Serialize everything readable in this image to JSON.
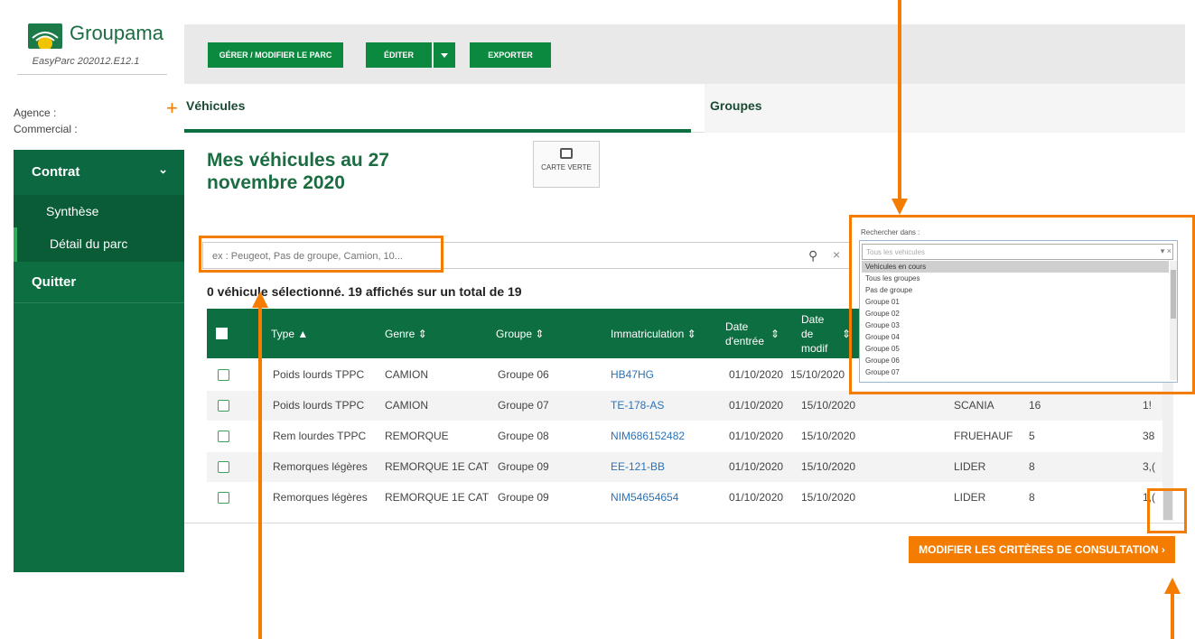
{
  "brand": {
    "name": "Groupama",
    "version": "EasyParc 202012.E12.1"
  },
  "sidebar": {
    "agence_label": "Agence :",
    "commercial_label": "Commercial :",
    "add_icon": "plus-icon",
    "menu": {
      "contrat": "Contrat",
      "synthese": "Synthèse",
      "detail": "Détail du parc",
      "quitter": "Quitter"
    }
  },
  "toolbar": {
    "gerer": "GÉRER / MODIFIER LE PARC",
    "editer": "ÉDITER",
    "exporter": "EXPORTER"
  },
  "tabs": {
    "vehicules": "Véhicules",
    "groupes": "Groupes"
  },
  "main": {
    "title": "Mes véhicules au 27 novembre 2020",
    "carte_verte": "CARTE VERTE",
    "search_placeholder": "ex : Peugeot, Pas de groupe, Camion, 10...",
    "selection_info": "0 véhicule sélectionné. 19 affichés sur un total de 19",
    "modify_button": "MODIFIER LES CRITÈRES DE CONSULTATION"
  },
  "filter": {
    "label": "Rechercher dans :",
    "placeholder": "Tous les vehicules",
    "options": [
      "Vehicules en cours",
      "Tous les groupes",
      "Pas de groupe",
      "Groupe 01",
      "Groupe 02",
      "Groupe 03",
      "Groupe 04",
      "Groupe 05",
      "Groupe 06",
      "Groupe 07"
    ],
    "highlighted_index": 0
  },
  "table": {
    "headers": {
      "type": "Type",
      "genre": "Genre",
      "groupe": "Groupe",
      "immat": "Immatriculation",
      "date_entree": "Date d'entrée",
      "date_modif": "Date de modif"
    },
    "rows": [
      {
        "type": "Poids lourds TPPC",
        "genre": "CAMION",
        "groupe": "Groupe 06",
        "immat": "HB47HG",
        "entree": "01/10/2020",
        "modif": "15/10/2020",
        "marque": "",
        "nb": "",
        "last": ""
      },
      {
        "type": "Poids lourds TPPC",
        "genre": "CAMION",
        "groupe": "Groupe 07",
        "immat": "TE-178-AS",
        "entree": "01/10/2020",
        "modif": "15/10/2020",
        "marque": "SCANIA",
        "nb": "16",
        "last": "1!"
      },
      {
        "type": "Rem lourdes TPPC",
        "genre": "REMORQUE",
        "groupe": "Groupe 08",
        "immat": "NIM686152482",
        "entree": "01/10/2020",
        "modif": "15/10/2020",
        "marque": "FRUEHAUF",
        "nb": "5",
        "last": "38"
      },
      {
        "type": "Remorques légères",
        "genre": "REMORQUE 1E CAT",
        "groupe": "Groupe 09",
        "immat": "EE-121-BB",
        "entree": "01/10/2020",
        "modif": "15/10/2020",
        "marque": "LIDER",
        "nb": "8",
        "last": "3,("
      },
      {
        "type": "Remorques légères",
        "genre": "REMORQUE 1E CAT",
        "groupe": "Groupe 09",
        "immat": "NIM54654654",
        "entree": "01/10/2020",
        "modif": "15/10/2020",
        "marque": "LIDER",
        "nb": "8",
        "last": "1,("
      }
    ]
  },
  "colors": {
    "brand_green": "#0d6e42",
    "button_green": "#0b8a3f",
    "accent_orange": "#f47c00",
    "link_blue": "#2b73b8"
  }
}
